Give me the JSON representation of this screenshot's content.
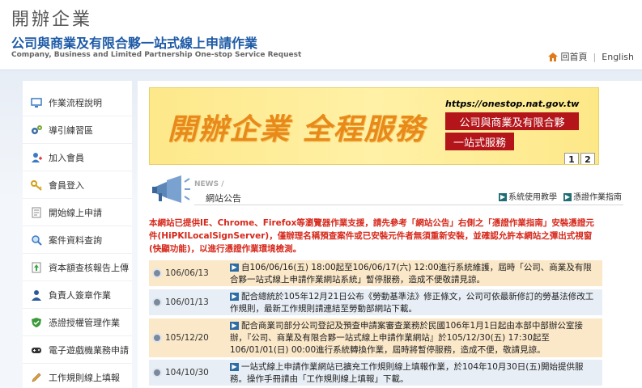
{
  "header": {
    "site_name": "開辦企業",
    "site_subtitle": "公司與商業及有限合夥一站式線上申請作業",
    "site_english": "Company, Business and Limited Partnership One-stop Service Request",
    "home_label": "回首頁",
    "english_label": "English",
    "separator": "|"
  },
  "sidebar": {
    "items": [
      {
        "label": "作業流程說明",
        "icon": "monitor-icon"
      },
      {
        "label": "導引練習區",
        "icon": "gears-icon"
      },
      {
        "label": "加入會員",
        "icon": "user-add-icon"
      },
      {
        "label": "會員登入",
        "icon": "key-icon"
      },
      {
        "label": "開始線上申請",
        "icon": "document-icon"
      },
      {
        "label": "案件資料查詢",
        "icon": "search-icon"
      },
      {
        "label": "資本額查核報告上傳",
        "icon": "upload-icon"
      },
      {
        "label": "負責人簽章作業",
        "icon": "person-icon"
      },
      {
        "label": "憑證授權管理作業",
        "icon": "shield-icon"
      },
      {
        "label": "電子遊戲機業務申請",
        "icon": "gamepad-icon"
      },
      {
        "label": "工作規則線上填報",
        "icon": "pencil-icon"
      }
    ]
  },
  "banner": {
    "slogan": "開辦企業 全程服務",
    "url": "https://onestop.nat.gov.tw",
    "box1": "公司與商業及有限合夥",
    "box2": "一站式服務",
    "pages": [
      "1",
      "2"
    ]
  },
  "news": {
    "title_en": "NEWS /",
    "title_zh": "網站公告",
    "link1": "系統使用教學",
    "link2": "憑證作業指南",
    "warning": "本網站已提供IE、Chrome、Firefox等瀏覽器作業支援，請先參考「網站公告」右側之「憑證作業指南」安裝憑證元件(HiPKILocalSignServer)，僅辦理名稱預查案件或已安裝元件者無須重新安裝，並確認允許本網站之彈出式視窗(快顯功能)，以進行憑證作業環境檢測。",
    "items": [
      {
        "date": "106/06/13",
        "text": "自106/06/16(五) 18:00起至106/06/17(六) 12:00進行系統維護，屆時「公司、商業及有限合夥一站式線上申請作業網站系統」暫停服務，造成不便敬請見諒。"
      },
      {
        "date": "106/01/13",
        "text": "配合總統於105年12月21日公布《勞動基準法》修正條文，公司可依最新修訂的勞基法修改工作規則，最新工作規則請連結至勞動部網站下載。"
      },
      {
        "date": "105/12/20",
        "text": "配合商業司部分公司登記及預查申請案審查業務於民國106年1月1日起由本部中部辦公室接辦，『公司、商業及有限合夥一站式線上申請作業網站』於105/12/30(五) 17:30起至106/01/01(日) 00:00進行系統轉換作業，屆時將暫停服務，造成不便，敬請見諒。"
      },
      {
        "date": "104/10/30",
        "text": "一站式線上申請作業網站已擴充工作規則線上填報作業，於104年10月30日(五)開始提供服務。操作手冊請由「工作規則線上填報」下載。"
      }
    ]
  },
  "colors": {
    "accent_blue": "#1d5aa6",
    "warning_red": "#d6281b",
    "banner_red": "#b3151a",
    "row_odd": "#fbe8c9",
    "row_even": "#e7eef5"
  }
}
